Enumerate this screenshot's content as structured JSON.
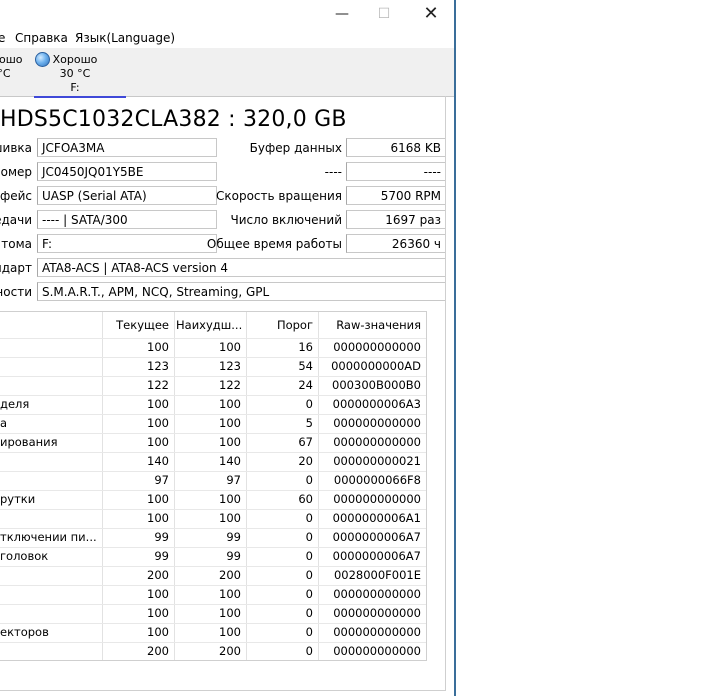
{
  "window": {
    "minimize_glyph": "—",
    "maximize_glyph": "☐",
    "close_glyph": "✕"
  },
  "menu": [
    "е",
    "Справка",
    "Язык(Language)"
  ],
  "drives": [
    {
      "status": "рошо",
      "temp": "°C",
      "letter": ""
    },
    {
      "status": "Хорошо",
      "temp": "30 °C",
      "letter": "F:",
      "icon": "globe-icon",
      "icon_color": "#4a90e2"
    }
  ],
  "disk": {
    "title": "HDS5C1032CLA382 : 320,0 GB"
  },
  "left_fields": [
    {
      "label": "шивка",
      "value": "JCFOA3MA"
    },
    {
      "label": "номер",
      "value": "JC0450JQ01Y5BE"
    },
    {
      "label": "рфейс",
      "value": "UASP (Serial ATA)"
    },
    {
      "label": "едачи",
      "value": "---- | SATA/300"
    },
    {
      "label": "ка тома",
      "value": "F:"
    }
  ],
  "right_fields": [
    {
      "label": "Буфер данных",
      "value": "6168 KB"
    },
    {
      "label": "----",
      "value": "----"
    },
    {
      "label": "Скорость вращения",
      "value": "5700 RPM"
    },
    {
      "label": "Число включений",
      "value": "1697 раз"
    },
    {
      "label": "Общее время работы",
      "value": "26360 ч"
    }
  ],
  "wide_fields": [
    {
      "label": "ндарт",
      "value": "ATA8-ACS | ATA8-ACS version 4"
    },
    {
      "label": "ности",
      "value": "S.M.A.R.T., APM, NCQ, Streaming, GPL"
    }
  ],
  "smart_table": {
    "columns": [
      "",
      "Текущее",
      "Наихудш...",
      "Порог",
      "Raw-значения"
    ],
    "rows": [
      [
        "",
        "100",
        "100",
        "16",
        "000000000000"
      ],
      [
        "",
        "123",
        "123",
        "54",
        "0000000000AD"
      ],
      [
        "",
        "122",
        "122",
        "24",
        "000300B000B0"
      ],
      [
        "деля",
        "100",
        "100",
        "0",
        "0000000006A3"
      ],
      [
        "а",
        "100",
        "100",
        "5",
        "000000000000"
      ],
      [
        "ирования",
        "100",
        "100",
        "67",
        "000000000000"
      ],
      [
        "",
        "140",
        "140",
        "20",
        "000000000021"
      ],
      [
        "",
        "97",
        "97",
        "0",
        "0000000066F8"
      ],
      [
        "рутки",
        "100",
        "100",
        "60",
        "000000000000"
      ],
      [
        "",
        "100",
        "100",
        "0",
        "0000000006A1"
      ],
      [
        "тключении пи...",
        "99",
        "99",
        "0",
        "0000000006A7"
      ],
      [
        "головок",
        "99",
        "99",
        "0",
        "0000000006A7"
      ],
      [
        "",
        "200",
        "200",
        "0",
        "0028000F001E"
      ],
      [
        "",
        "100",
        "100",
        "0",
        "000000000000"
      ],
      [
        "",
        "100",
        "100",
        "0",
        "000000000000"
      ],
      [
        "екторов",
        "100",
        "100",
        "0",
        "000000000000"
      ],
      [
        "",
        "200",
        "200",
        "0",
        "000000000000"
      ]
    ]
  }
}
